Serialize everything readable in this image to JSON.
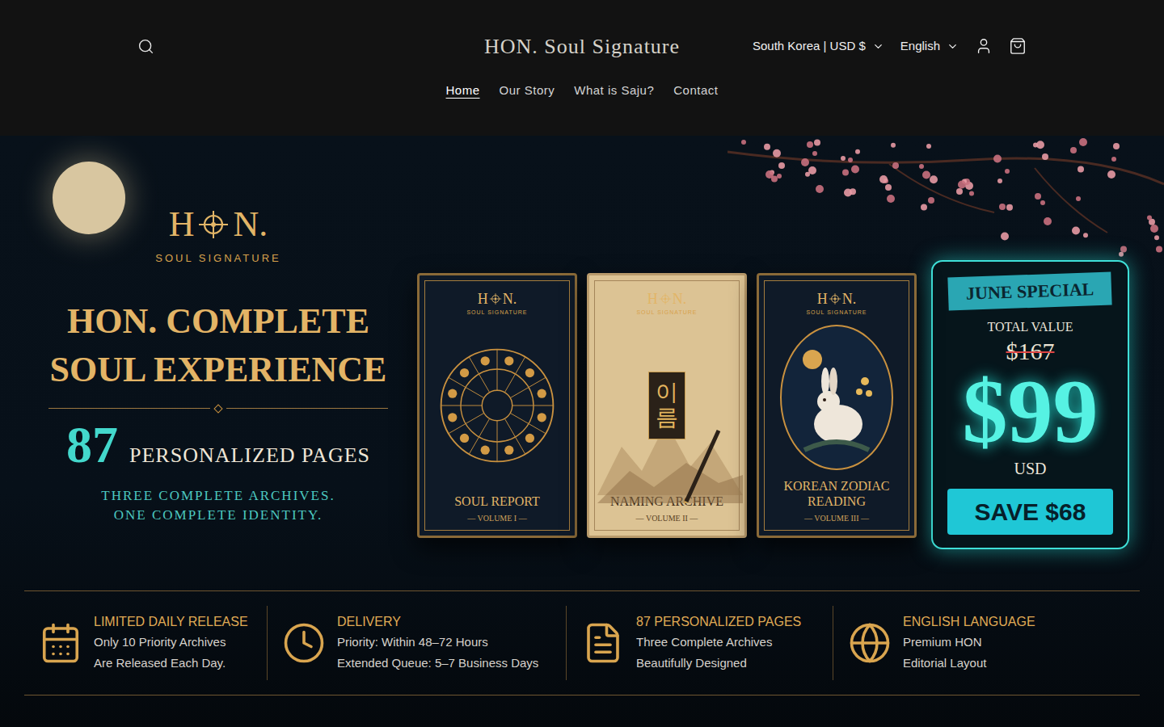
{
  "header": {
    "brand": "HON. Soul Signature",
    "region": "South Korea | USD $",
    "language": "English"
  },
  "nav": [
    {
      "label": "Home",
      "selected": true
    },
    {
      "label": "Our Story",
      "selected": false
    },
    {
      "label": "What is Saju?",
      "selected": false
    },
    {
      "label": "Contact",
      "selected": false
    }
  ],
  "hero": {
    "logo": {
      "left": "H",
      "right": "N.",
      "tagline": "SOUL SIGNATURE"
    },
    "title_lines": [
      "HON. COMPLETE",
      "SOUL EXPERIENCE"
    ],
    "pages_count": "87",
    "pages_label": "PERSONALIZED PAGES",
    "subtitle_lines": [
      "THREE COMPLETE ARCHIVES.",
      "ONE COMPLETE IDENTITY."
    ]
  },
  "books": [
    {
      "kind": "zodiac-wheel",
      "title_lines": [
        "SOUL REPORT"
      ],
      "volume": "— VOLUME I —",
      "vertical_text": ""
    },
    {
      "kind": "naming",
      "title_lines": [
        "NAMING ARCHIVE"
      ],
      "volume": "— VOLUME II —",
      "vertical_text": "이름"
    },
    {
      "kind": "rabbit",
      "title_lines": [
        "KOREAN ZODIAC",
        "READING"
      ],
      "volume": "— VOLUME III —",
      "vertical_text": ""
    }
  ],
  "offer": {
    "ribbon": "JUNE SPECIAL",
    "total_label": "TOTAL VALUE",
    "old_price": "$167",
    "price": "$99",
    "currency": "USD",
    "save": "SAVE $68"
  },
  "features": [
    {
      "title": "LIMITED DAILY RELEASE",
      "lines": [
        "Only 10 Priority Archives",
        "Are Released Each Day."
      ]
    },
    {
      "title": "DELIVERY",
      "lines": [
        "Priority: Within 48–72 Hours",
        "Extended Queue: 5–7 Business Days"
      ]
    },
    {
      "title": "87 PERSONALIZED PAGES",
      "lines": [
        "Three Complete Archives",
        "Beautifully Designed"
      ]
    },
    {
      "title": "ENGLISH LANGUAGE",
      "lines": [
        "Premium HON",
        "Editorial Layout"
      ]
    }
  ]
}
